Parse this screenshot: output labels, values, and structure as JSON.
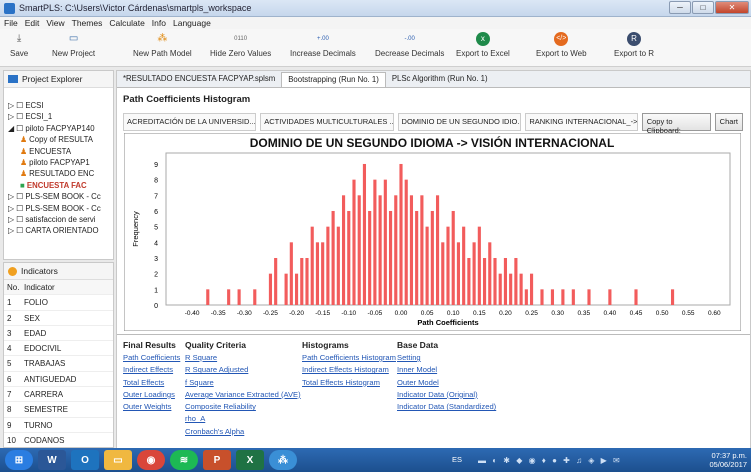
{
  "window": {
    "title": "SmartPLS: C:\\Users\\Victor Cárdenas\\smartpls_workspace"
  },
  "menu": [
    "File",
    "Edit",
    "View",
    "Themes",
    "Calculate",
    "Info",
    "Language"
  ],
  "toolbar": [
    {
      "label": "Save",
      "icon": "save-icon"
    },
    {
      "label": "New Project",
      "icon": "folder-icon"
    },
    {
      "label": "New Path Model",
      "icon": "path-model-icon"
    },
    {
      "label": "Hide Zero Values",
      "icon": "zero-values-icon"
    },
    {
      "label": "Increase Decimals",
      "icon": "increase-decimals-icon"
    },
    {
      "label": "Decrease Decimals",
      "icon": "decrease-decimals-icon"
    },
    {
      "label": "Export to Excel",
      "icon": "excel-icon"
    },
    {
      "label": "Export to Web",
      "icon": "web-icon"
    },
    {
      "label": "Export to R",
      "icon": "r-icon"
    }
  ],
  "explorer": {
    "title": "Project Explorer",
    "items": [
      "ECSI",
      "ECSI_1",
      "piloto FACPYAP140",
      "Copy of RESULTA",
      "ENCUESTA",
      "piloto FACPYAP1",
      "RESULTADO ENC",
      "ENCUESTA FAC",
      "PLS-SEM BOOK - Cc",
      "PLS-SEM BOOK - Cc",
      "satisfaccion de servi",
      "CARTA ORIENTADO"
    ]
  },
  "indicators": {
    "title": "Indicators",
    "header": [
      "No.",
      "Indicator"
    ],
    "rows": [
      [
        "1",
        "FOLIO"
      ],
      [
        "2",
        "SEX"
      ],
      [
        "3",
        "EDAD"
      ],
      [
        "4",
        "EDOCIVIL"
      ],
      [
        "5",
        "TRABAJAS"
      ],
      [
        "6",
        "ANTIGUEDAD"
      ],
      [
        "7",
        "CARRERA"
      ],
      [
        "8",
        "SEMESTRE"
      ],
      [
        "9",
        "TURNO"
      ],
      [
        "10",
        "CODANOS"
      ]
    ]
  },
  "tabs": [
    "*RESULTADO ENCUESTA FACPYAP.splsm",
    "Bootstrapping (Run No. 1)",
    "PLSc Algorithm (Run No. 1)"
  ],
  "page_title": "Path Coefficients Histogram",
  "subtabs": [
    "ACREDITACIÓN DE LA UNIVERSID...",
    "ACTIVIDADES MULTICULTURALES ...",
    "DOMINIO DE UN SEGUNDO IDIO...",
    "RANKING INTERNACIONAL_-> VIS..."
  ],
  "copy_label": "Copy to Clipboard:",
  "chart_button": "Chart",
  "bottom": {
    "final_results": {
      "title": "Final Results",
      "links": [
        "Path Coefficients",
        "Indirect Effects",
        "Total Effects",
        "Outer Loadings",
        "Outer Weights"
      ]
    },
    "quality": {
      "title": "Quality Criteria",
      "links": [
        "R Square",
        "R Square Adjusted",
        "f Square",
        "Average Variance Extracted (AVE)",
        "Composite Reliability",
        "rho_A",
        "Cronbach's Alpha"
      ]
    },
    "histograms": {
      "title": "Histograms",
      "links": [
        "Path Coefficients Histogram",
        "Indirect Effects Histogram",
        "Total Effects Histogram"
      ]
    },
    "base": {
      "title": "Base Data",
      "links": [
        "Setting",
        "Inner Model",
        "Outer Model",
        "Indicator Data (Original)",
        "Indicator Data (Standardized)"
      ]
    }
  },
  "taskbar": {
    "time": "07:37 p.m.",
    "date": "05/06/2017",
    "lang": "ES"
  },
  "chart_data": {
    "type": "bar",
    "title": "DOMINIO DE UN SEGUNDO IDIOMA -> VISIÓN INTERNACIONAL",
    "xlabel": "Path Coefficients",
    "ylabel": "Frequency",
    "xlim": [
      -0.45,
      0.63
    ],
    "ylim": [
      0,
      9.7
    ],
    "xticks": [
      "-0.40",
      "-0.35",
      "-0.30",
      "-0.25",
      "-0.20",
      "-0.15",
      "-0.10",
      "-0.05",
      "0.00",
      "0.05",
      "0.10",
      "0.15",
      "0.20",
      "0.25",
      "0.30",
      "0.35",
      "0.40",
      "0.45",
      "0.50",
      "0.55",
      "0.60"
    ],
    "yticks": [
      "0",
      "1",
      "2",
      "3",
      "4",
      "5",
      "6",
      "7",
      "8",
      "9"
    ],
    "color": "#f25c5c",
    "x": [
      -0.37,
      -0.33,
      -0.31,
      -0.28,
      -0.25,
      -0.24,
      -0.22,
      -0.21,
      -0.2,
      -0.19,
      -0.18,
      -0.17,
      -0.16,
      -0.15,
      -0.14,
      -0.13,
      -0.12,
      -0.11,
      -0.1,
      -0.09,
      -0.08,
      -0.07,
      -0.06,
      -0.05,
      -0.04,
      -0.03,
      -0.02,
      -0.01,
      0.0,
      0.01,
      0.02,
      0.03,
      0.04,
      0.05,
      0.06,
      0.07,
      0.08,
      0.09,
      0.1,
      0.11,
      0.12,
      0.13,
      0.14,
      0.15,
      0.16,
      0.17,
      0.18,
      0.19,
      0.2,
      0.21,
      0.22,
      0.23,
      0.24,
      0.25,
      0.27,
      0.29,
      0.31,
      0.33,
      0.36,
      0.4,
      0.45,
      0.52
    ],
    "values": [
      1,
      1,
      1,
      1,
      2,
      3,
      2,
      4,
      2,
      3,
      3,
      5,
      4,
      4,
      5,
      6,
      5,
      7,
      6,
      8,
      7,
      9,
      6,
      8,
      7,
      8,
      6,
      7,
      9,
      8,
      7,
      6,
      7,
      5,
      6,
      7,
      4,
      5,
      6,
      4,
      5,
      3,
      4,
      5,
      3,
      4,
      3,
      2,
      3,
      2,
      3,
      2,
      1,
      2,
      1,
      1,
      1,
      1,
      1,
      1,
      1,
      1
    ]
  }
}
